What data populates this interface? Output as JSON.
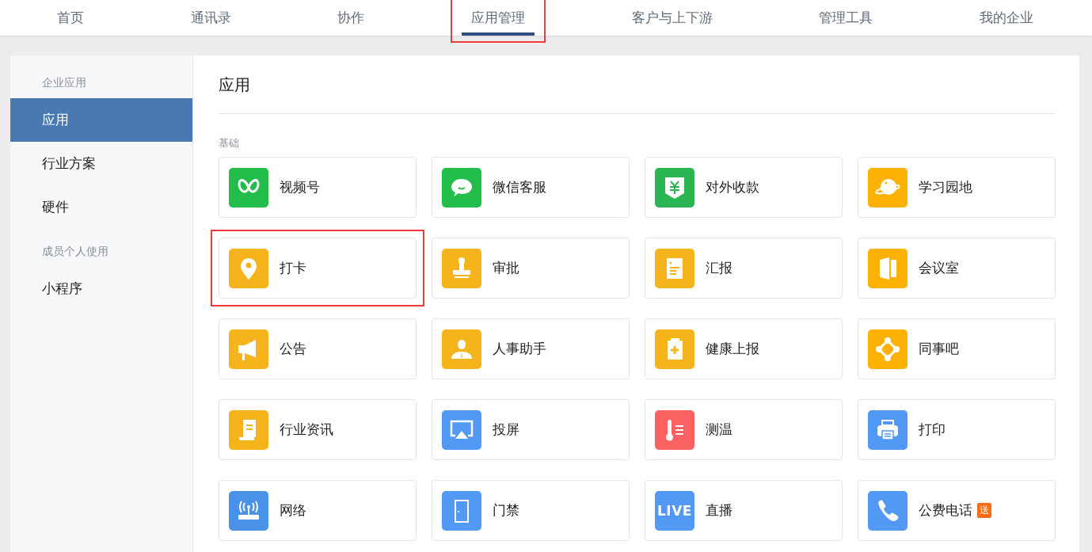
{
  "nav": {
    "tabs": [
      {
        "label": "首页",
        "selected": false,
        "highlighted": false
      },
      {
        "label": "通讯录",
        "selected": false,
        "highlighted": false
      },
      {
        "label": "协作",
        "selected": false,
        "highlighted": false
      },
      {
        "label": "应用管理",
        "selected": true,
        "highlighted": true
      },
      {
        "label": "客户与上下游",
        "selected": false,
        "highlighted": false
      },
      {
        "label": "管理工具",
        "selected": false,
        "highlighted": false
      },
      {
        "label": "我的企业",
        "selected": false,
        "highlighted": false
      }
    ]
  },
  "sidebar": {
    "groups": [
      {
        "label": "企业应用",
        "items": [
          {
            "label": "应用",
            "selected": true
          },
          {
            "label": "行业方案",
            "selected": false
          },
          {
            "label": "硬件",
            "selected": false
          }
        ]
      },
      {
        "label": "成员个人使用",
        "items": [
          {
            "label": "小程序",
            "selected": false
          }
        ]
      }
    ]
  },
  "content": {
    "title": "应用",
    "section": "基础",
    "apps": [
      {
        "name": "视频号",
        "kind": "channels",
        "color": "#22bd4b",
        "highlighted": false
      },
      {
        "name": "微信客服",
        "kind": "chat",
        "color": "#22bd4b",
        "highlighted": false
      },
      {
        "name": "对外收款",
        "kind": "payment",
        "color": "#2cb553",
        "highlighted": false
      },
      {
        "name": "学习园地",
        "kind": "planet",
        "color": "#fcb105",
        "highlighted": false
      },
      {
        "name": "打卡",
        "kind": "pin",
        "color": "#f5b41c",
        "highlighted": true
      },
      {
        "name": "审批",
        "kind": "stamp",
        "color": "#f5b41c",
        "highlighted": false
      },
      {
        "name": "汇报",
        "kind": "report",
        "color": "#f5b41c",
        "highlighted": false
      },
      {
        "name": "会议室",
        "kind": "door",
        "color": "#fcb105",
        "highlighted": false
      },
      {
        "name": "公告",
        "kind": "megaphone",
        "color": "#f5b41c",
        "highlighted": false
      },
      {
        "name": "人事助手",
        "kind": "person",
        "color": "#f5b41c",
        "highlighted": false
      },
      {
        "name": "健康上报",
        "kind": "clipboard",
        "color": "#f5b41c",
        "highlighted": false
      },
      {
        "name": "同事吧",
        "kind": "network",
        "color": "#fcb105",
        "highlighted": false
      },
      {
        "name": "行业资讯",
        "kind": "scroll",
        "color": "#f5b41c",
        "highlighted": false
      },
      {
        "name": "投屏",
        "kind": "screen",
        "color": "#5199f4",
        "highlighted": false
      },
      {
        "name": "测温",
        "kind": "thermometer",
        "color": "#fc6262",
        "highlighted": false
      },
      {
        "name": "打印",
        "kind": "printer",
        "color": "#5199f4",
        "highlighted": false
      },
      {
        "name": "网络",
        "kind": "router",
        "color": "#4a91e8",
        "highlighted": false
      },
      {
        "name": "门禁",
        "kind": "doorway",
        "color": "#5199f4",
        "highlighted": false
      },
      {
        "name": "直播",
        "kind": "live",
        "icon_text": "LIVE",
        "color": "#5199f4",
        "highlighted": false
      },
      {
        "name": "公费电话",
        "kind": "phone",
        "color": "#5199f4",
        "highlighted": false,
        "badge": "送"
      }
    ]
  }
}
